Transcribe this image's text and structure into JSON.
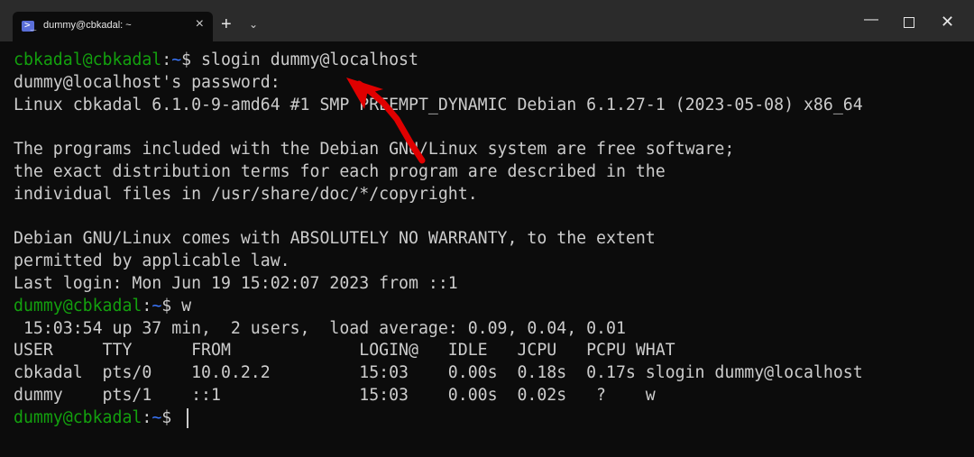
{
  "window": {
    "tab_title": "dummy@cbkadal: ~",
    "tab_close": "×",
    "new_tab": "+",
    "dropdown": "⌄",
    "minimize": "—",
    "close": "✕"
  },
  "colors": {
    "background": "#0c0c0c",
    "prompt_user": "#13a10e",
    "prompt_path": "#3b78ff",
    "arrow": "#e00000"
  },
  "terminal": {
    "line1": {
      "user": "cbkadal@cbkadal",
      "colon": ":",
      "path": "~",
      "rest": "$ slogin dummy@localhost"
    },
    "line2": "dummy@localhost's password:",
    "line3": "Linux cbkadal 6.1.0-9-amd64 #1 SMP PREEMPT_DYNAMIC Debian 6.1.27-1 (2023-05-08) x86_64",
    "line4": "",
    "line5": "The programs included with the Debian GNU/Linux system are free software;",
    "line6": "the exact distribution terms for each program are described in the",
    "line7": "individual files in /usr/share/doc/*/copyright.",
    "line8": "",
    "line9": "Debian GNU/Linux comes with ABSOLUTELY NO WARRANTY, to the extent",
    "line10": "permitted by applicable law.",
    "line11": "Last login: Mon Jun 19 15:02:07 2023 from ::1",
    "line12": {
      "user": "dummy@cbkadal",
      "colon": ":",
      "path": "~",
      "rest": "$ w"
    },
    "line13": " 15:03:54 up 37 min,  2 users,  load average: 0.09, 0.04, 0.01",
    "line14": "USER     TTY      FROM             LOGIN@   IDLE   JCPU   PCPU WHAT",
    "line15": "cbkadal  pts/0    10.0.2.2         15:03    0.00s  0.18s  0.17s slogin dummy@localhost",
    "line16": "dummy    pts/1    ::1              15:03    0.00s  0.02s   ?    w",
    "line17": {
      "user": "dummy@cbkadal",
      "colon": ":",
      "path": "~",
      "rest": "$ "
    }
  }
}
